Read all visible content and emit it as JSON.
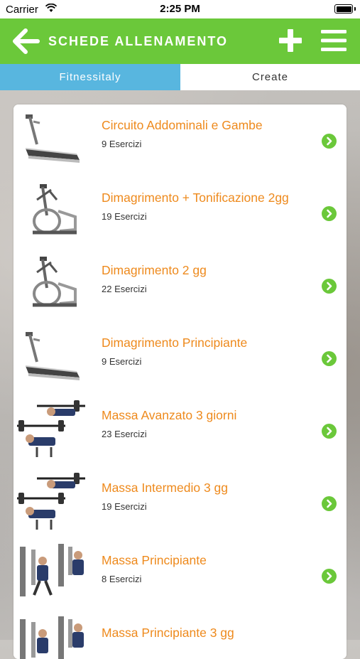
{
  "status_bar": {
    "carrier": "Carrier",
    "time": "2:25 PM"
  },
  "nav": {
    "title": "SCHEDE ALLENAMENTO",
    "back_icon": "arrow-left-icon",
    "add_icon": "plus-icon",
    "menu_icon": "hamburger-icon"
  },
  "tabs": [
    {
      "label": "Fitnessitaly",
      "active": true
    },
    {
      "label": "Create",
      "active": false
    }
  ],
  "colors": {
    "brand_green": "#6bc83a",
    "tab_active_blue": "#58b6df",
    "title_orange": "#ee8a1d"
  },
  "workouts": [
    {
      "title": "Circuito Addominali e Gambe",
      "count": "9 Esercizi",
      "thumbnail": "treadmill"
    },
    {
      "title": "Dimagrimento + Tonificazione 2gg",
      "count": "19 Esercizi",
      "thumbnail": "elliptical"
    },
    {
      "title": "Dimagrimento 2 gg",
      "count": "22 Esercizi",
      "thumbnail": "elliptical"
    },
    {
      "title": "Dimagrimento Principiante",
      "count": "9 Esercizi",
      "thumbnail": "treadmill"
    },
    {
      "title": "Massa Avanzato 3 giorni",
      "count": "23 Esercizi",
      "thumbnail": "bench-press"
    },
    {
      "title": "Massa Intermedio 3 gg",
      "count": "19 Esercizi",
      "thumbnail": "bench-press"
    },
    {
      "title": "Massa Principiante",
      "count": "8 Esercizi",
      "thumbnail": "chest-press-machine"
    },
    {
      "title": "Massa Principiante 3 gg",
      "count": "",
      "thumbnail": "chest-press-machine"
    }
  ]
}
